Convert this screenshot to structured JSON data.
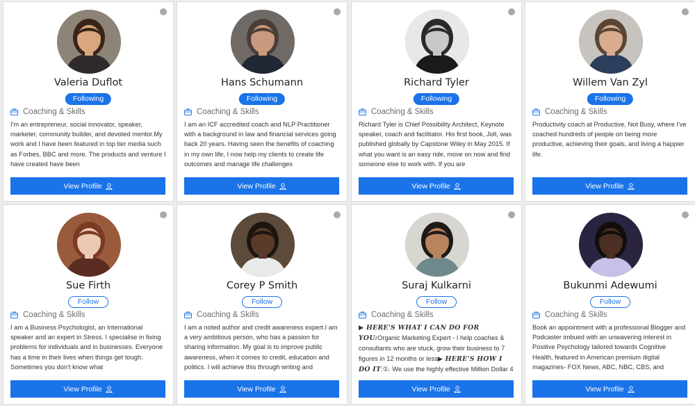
{
  "profiles": [
    {
      "name": "Valeria Duflot",
      "follow_label": "Following",
      "category": "Coaching & Skills",
      "bio": "I'm an entrepreneur, social innovator, speaker, marketer, community builder, and devoted mentor.My work and I have been featured in top tier media such as Forbes, BBC and more. The products and venture I have created have been",
      "view_label": "View Profile",
      "avatar_colors": {
        "bg": "#8d8478",
        "skin": "#d9a77e",
        "hair": "#3a2418",
        "top": "#2e2a2a"
      }
    },
    {
      "name": "Hans Schumann",
      "follow_label": "Following",
      "category": "Coaching & Skills",
      "bio": "I am an ICF accredited coach and NLP Practitioner with a background in law and financial services going back 20 years. Having seen the benefits of coaching in my own life, I now help my clients to create life outcomes and manage life challenges",
      "view_label": "View Profile",
      "avatar_colors": {
        "bg": "#6f6a66",
        "skin": "#c99a7d",
        "hair": "#4a3f38",
        "top": "#1f2733"
      }
    },
    {
      "name": "Richard Tyler",
      "follow_label": "Following",
      "category": "Coaching & Skills",
      "bio": "Richard Tyler is Chief Possibility Architect, Keynote speaker, coach and facilitator. His first book, Jolt, was published globally by Capstone Wiley in May 2015. If what you want is an easy ride, move on now and find someone else to work with. If you are",
      "view_label": "View Profile",
      "avatar_colors": {
        "bg": "#e8e8e8",
        "skin": "#c8c8c8",
        "hair": "#2a2a2a",
        "top": "#1a1a1a"
      }
    },
    {
      "name": "Willem Van Zyl",
      "follow_label": "Following",
      "category": "Coaching & Skills",
      "bio": "Productivity coach at Productive, Not Busy, where I've coached hundreds of people on being more productive, achieving their goals, and living a happier life.",
      "view_label": "View Profile",
      "avatar_colors": {
        "bg": "#c7c3be",
        "skin": "#d8ac8c",
        "hair": "#5a4535",
        "top": "#2c3e5c"
      }
    },
    {
      "name": "Sue Firth",
      "follow_label": "Follow",
      "category": "Coaching & Skills",
      "bio": "I am a Business Psychologist, an International speaker and an expert in Stress.  I specialise in fixing problems for individuals and in businesses. Everyone has a time in their lives when things get tough. Sometimes you don't know what",
      "view_label": "View Profile",
      "avatar_colors": {
        "bg": "#9a5a3c",
        "skin": "#ecc9b3",
        "hair": "#7a3a24",
        "top": "#5b2c22"
      }
    },
    {
      "name": "Corey P Smith",
      "follow_label": "Follow",
      "category": "Coaching & Skills",
      "bio": "I am a noted author and credit awareness expert.I am a very ambitious person, who has a passion for sharing information. My goal is to improve public awareness, when it comes to credit, education and politics. I will achieve this through writing and",
      "view_label": "View Profile",
      "avatar_colors": {
        "bg": "#5c4a3a",
        "skin": "#5a3a28",
        "hair": "#1c1512",
        "top": "#e9e9e9"
      }
    },
    {
      "name": "Suraj Kulkarni",
      "follow_label": "Follow",
      "category": "Coaching & Skills",
      "bio_parts": [
        {
          "bold": true,
          "text": "▶ HERE'S WHAT I CAN DO FOR YOU:"
        },
        {
          "bold": false,
          "text": "Organic Marketing Expert - I help coaches & consultants who are stuck, grow their business to 7 figures in 12 months or less"
        },
        {
          "bold": true,
          "text": "▶ HERE'S HOW I DO IT"
        },
        {
          "bold": false,
          "text": ":①. We use the highly effective Million Dollar 4"
        }
      ],
      "view_label": "View Profile",
      "avatar_colors": {
        "bg": "#d8d6d0",
        "skin": "#b8845e",
        "hair": "#1e1a18",
        "top": "#6e8a8c"
      }
    },
    {
      "name": "Bukunmi Adewumi",
      "follow_label": "Follow",
      "category": "Coaching & Skills",
      "bio": "Book an appointment with a professional Blogger and Podcaster imbued with an unwavering interest in Positive Psychology tailored towards Cognitive Health, featured in American premium digital magazines- FOX News, ABC, NBC, CBS, and",
      "view_label": "View Profile",
      "avatar_colors": {
        "bg": "#2a2440",
        "skin": "#4a2f22",
        "hair": "#120e0c",
        "top": "#c8c0e8"
      }
    }
  ],
  "colors": {
    "accent": "#1a73e8",
    "status_dot": "#a9a9a9"
  },
  "icons": {
    "category": "briefcase-icon",
    "view": "user-icon",
    "status": "status-dot"
  }
}
